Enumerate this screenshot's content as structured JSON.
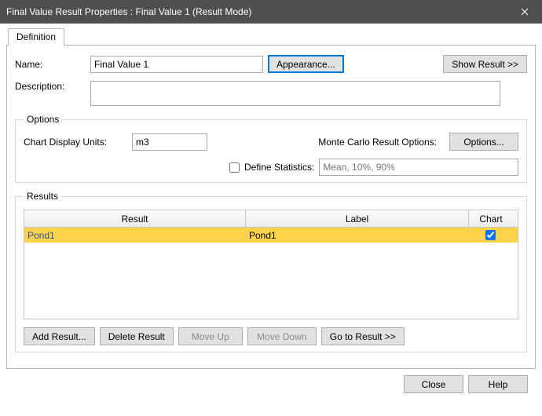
{
  "window": {
    "title": "Final Value Result Properties : Final Value 1 (Result Mode)"
  },
  "tabs": {
    "definition": "Definition"
  },
  "form": {
    "name_label": "Name:",
    "name_value": "Final Value 1",
    "appearance_btn": "Appearance...",
    "show_result_btn": "Show Result >>",
    "description_label": "Description:",
    "description_value": ""
  },
  "options": {
    "legend": "Options",
    "chart_units_label": "Chart Display Units:",
    "chart_units_value": "m3",
    "mc_label": "Monte Carlo Result Options:",
    "mc_btn": "Options...",
    "define_stats_label": "Define Statistics:",
    "define_stats_placeholder": "Mean, 10%, 90%",
    "define_stats_checked": false
  },
  "results": {
    "legend": "Results",
    "headers": {
      "result": "Result",
      "label": "Label",
      "chart": "Chart"
    },
    "rows": [
      {
        "result": "Pond1",
        "label": "Pond1",
        "chart": true
      }
    ],
    "buttons": {
      "add": "Add Result...",
      "delete": "Delete Result",
      "move_up": "Move Up",
      "move_down": "Move Down",
      "goto": "Go to Result >>"
    }
  },
  "footer": {
    "close": "Close",
    "help": "Help"
  }
}
